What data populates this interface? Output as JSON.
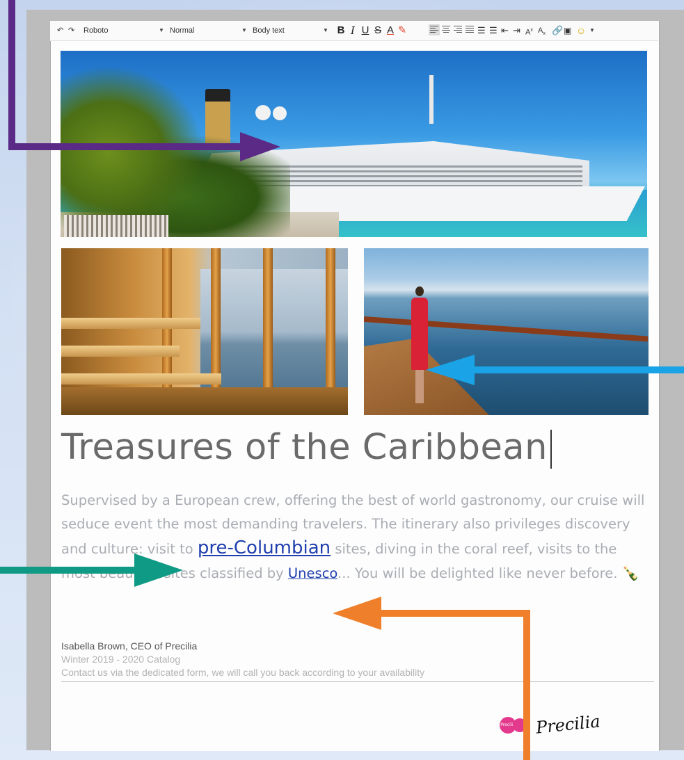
{
  "toolbar": {
    "undo_icon": "undo-icon",
    "redo_icon": "redo-icon",
    "font_family": "Roboto",
    "font_size": "Normal",
    "block_style": "Body text",
    "bold": "B",
    "italic": "I",
    "underline": "U",
    "strike": "S",
    "text_color": "A",
    "superscript": "A",
    "subscript": "A"
  },
  "content": {
    "title": "Treasures of the Caribbean",
    "paragraph_part1": "Supervised by a European crew, offering the best of world gastronomy, our cruise will seduce event the most demanding travelers. The itinerary also privileges discovery and culture: visit to ",
    "link_precolumbian": "pre-Columbian",
    "paragraph_part2": " sites, diving in the coral reef, visits to the most beautiful sites classified by ",
    "link_unesco": "Unesco",
    "paragraph_part3": "... You will be delighted like never before.",
    "emoji": "🍾",
    "signature_name": "Isabella Brown, CEO of Precilia",
    "catalog": "Winter 2019 - 2020 Catalog",
    "contact": "Contact us via the dedicated form, we will call you back according to your availability",
    "logo_text": "Precilia",
    "handwritten_signature": "Precilia"
  },
  "colors": {
    "purple_arrow": "#5a2a86",
    "blue_arrow": "#1aa3e6",
    "teal_arrow": "#0f9a85",
    "orange_arrow": "#ef7f2a"
  }
}
